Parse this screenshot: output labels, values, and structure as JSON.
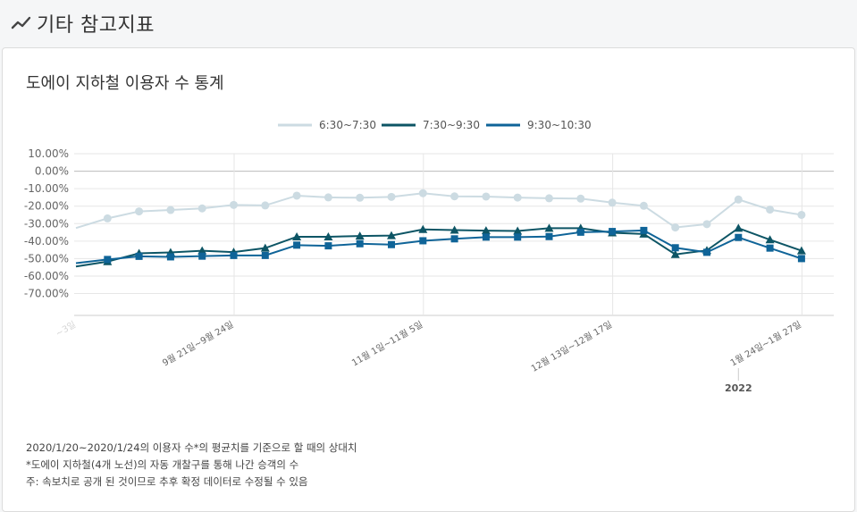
{
  "header": {
    "title": "기타 참고지표",
    "icon": "trend-line-icon"
  },
  "card": {
    "title": "도에이 지하철 이용자 수 통계"
  },
  "notes": [
    "2020/1/20~2020/1/24의 이용자 수*의 평균치를 기준으로 할 때의 상대치",
    "*도에이 지하철(4개 노선)의 자동 개찰구를 통해 나간 승객의 수",
    "주: 속보치로 공개 된 것이므로 추후 확정 데이터로 수정될 수 있음"
  ],
  "chart_data": {
    "type": "line",
    "title": "",
    "xlabel": "",
    "ylabel": "",
    "ylim": [
      -70,
      10
    ],
    "yticks": [
      "10.00%",
      "0.00%",
      "-10.00%",
      "-20.00%",
      "-30.00%",
      "-40.00%",
      "-50.00%",
      "-60.00%",
      "-70.00%"
    ],
    "xtick_labels": [
      {
        "index": 0,
        "label": "~3일",
        "faded": true
      },
      {
        "index": 5,
        "label": "9월 21일~9월 24일"
      },
      {
        "index": 11,
        "label": "11월 1일~11월 5일"
      },
      {
        "index": 17,
        "label": "12월 13일~12월 17일"
      },
      {
        "index": 23,
        "label": "1월 24일~1월 27일"
      }
    ],
    "year_label": {
      "index": 21,
      "label": "2022"
    },
    "legend_position": "top-center",
    "grid": true,
    "colors": {
      "s1": "#ccdbe2",
      "s2": "#0d5565",
      "s3": "#0f6498"
    },
    "series": [
      {
        "name": "6:30~7:30",
        "marker": "circle",
        "color": "#ccdbe2",
        "values": [
          -32.5,
          -27,
          -23,
          -22.2,
          -21.3,
          -19.3,
          -19.6,
          -14,
          -15,
          -15.2,
          -14.7,
          -12.6,
          -14.4,
          -14.5,
          -15.1,
          -15.5,
          -15.7,
          -18,
          -19.8,
          -32.2,
          -30.3,
          -16.2,
          -22,
          -25
        ]
      },
      {
        "name": "7:30~9:30",
        "marker": "triangle",
        "color": "#0d5565",
        "values": [
          -54.5,
          -51.7,
          -47,
          -46.5,
          -45.5,
          -46.3,
          -44,
          -37.5,
          -37.5,
          -37.1,
          -36.8,
          -33.3,
          -33.7,
          -34,
          -34.2,
          -32.6,
          -32.6,
          -35.2,
          -35.9,
          -47.6,
          -45.3,
          -32.6,
          -39.2,
          -45.5
        ]
      },
      {
        "name": "9:30~10:30",
        "marker": "square",
        "color": "#0f6498",
        "values": [
          -52.6,
          -50.5,
          -48.7,
          -49,
          -48.6,
          -48.2,
          -48.2,
          -42.3,
          -42.7,
          -41.5,
          -42,
          -39.8,
          -38.7,
          -37.7,
          -37.7,
          -37.4,
          -34.9,
          -34.5,
          -33.9,
          -43.8,
          -46.4,
          -37.9,
          -44,
          -50
        ]
      }
    ]
  }
}
